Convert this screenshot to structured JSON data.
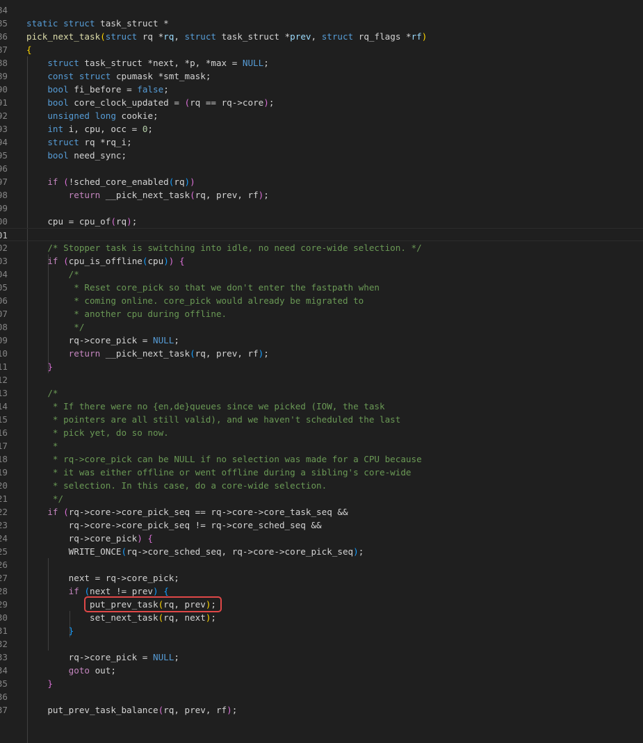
{
  "editor": {
    "language": "c",
    "lines": [
      {
        "n": "84",
        "t": []
      },
      {
        "n": "85",
        "t": [
          [
            "kw",
            "static"
          ],
          [
            "pl",
            " "
          ],
          [
            "kw",
            "struct"
          ],
          [
            "pl",
            " task_struct *"
          ]
        ]
      },
      {
        "n": "86",
        "t": [
          [
            "fn",
            "pick_next_task"
          ],
          [
            "p1",
            "("
          ],
          [
            "kw",
            "struct"
          ],
          [
            "pl",
            " rq *"
          ],
          [
            "var",
            "rq"
          ],
          [
            "pl",
            ", "
          ],
          [
            "kw",
            "struct"
          ],
          [
            "pl",
            " task_struct *"
          ],
          [
            "var",
            "prev"
          ],
          [
            "pl",
            ", "
          ],
          [
            "kw",
            "struct"
          ],
          [
            "pl",
            " rq_flags *"
          ],
          [
            "var",
            "rf"
          ],
          [
            "p1",
            ")"
          ]
        ]
      },
      {
        "n": "87",
        "t": [
          [
            "p1",
            "{"
          ]
        ]
      },
      {
        "n": "88",
        "t": [
          [
            "pl",
            "    "
          ],
          [
            "kw",
            "struct"
          ],
          [
            "pl",
            " task_struct *next, *p, *max = "
          ],
          [
            "kw",
            "NULL"
          ],
          [
            "pl",
            ";"
          ]
        ]
      },
      {
        "n": "89",
        "t": [
          [
            "pl",
            "    "
          ],
          [
            "kw",
            "const"
          ],
          [
            "pl",
            " "
          ],
          [
            "kw",
            "struct"
          ],
          [
            "pl",
            " cpumask *smt_mask;"
          ]
        ]
      },
      {
        "n": "90",
        "t": [
          [
            "pl",
            "    "
          ],
          [
            "kw",
            "bool"
          ],
          [
            "pl",
            " fi_before = "
          ],
          [
            "kw",
            "false"
          ],
          [
            "pl",
            ";"
          ]
        ]
      },
      {
        "n": "91",
        "t": [
          [
            "pl",
            "    "
          ],
          [
            "kw",
            "bool"
          ],
          [
            "pl",
            " core_clock_updated = "
          ],
          [
            "p2",
            "("
          ],
          [
            "pl",
            "rq == rq->core"
          ],
          [
            "p2",
            ")"
          ],
          [
            "pl",
            ";"
          ]
        ]
      },
      {
        "n": "92",
        "t": [
          [
            "pl",
            "    "
          ],
          [
            "kw",
            "unsigned"
          ],
          [
            "pl",
            " "
          ],
          [
            "kw",
            "long"
          ],
          [
            "pl",
            " cookie;"
          ]
        ]
      },
      {
        "n": "93",
        "t": [
          [
            "pl",
            "    "
          ],
          [
            "kw",
            "int"
          ],
          [
            "pl",
            " i, cpu, occ = "
          ],
          [
            "num",
            "0"
          ],
          [
            "pl",
            ";"
          ]
        ]
      },
      {
        "n": "94",
        "t": [
          [
            "pl",
            "    "
          ],
          [
            "kw",
            "struct"
          ],
          [
            "pl",
            " rq *rq_i;"
          ]
        ]
      },
      {
        "n": "95",
        "t": [
          [
            "pl",
            "    "
          ],
          [
            "kw",
            "bool"
          ],
          [
            "pl",
            " need_sync;"
          ]
        ]
      },
      {
        "n": "96",
        "t": []
      },
      {
        "n": "97",
        "t": [
          [
            "pl",
            "    "
          ],
          [
            "ctl",
            "if"
          ],
          [
            "pl",
            " "
          ],
          [
            "p2",
            "("
          ],
          [
            "pl",
            "!sched_core_enabled"
          ],
          [
            "p3",
            "("
          ],
          [
            "pl",
            "rq"
          ],
          [
            "p3",
            ")"
          ],
          [
            "p2",
            ")"
          ]
        ]
      },
      {
        "n": "98",
        "t": [
          [
            "pl",
            "        "
          ],
          [
            "ctl",
            "return"
          ],
          [
            "pl",
            " __pick_next_task"
          ],
          [
            "p2",
            "("
          ],
          [
            "pl",
            "rq, prev, rf"
          ],
          [
            "p2",
            ")"
          ],
          [
            "pl",
            ";"
          ]
        ]
      },
      {
        "n": "99",
        "t": []
      },
      {
        "n": "100",
        "t": [
          [
            "pl",
            "    cpu = cpu_of"
          ],
          [
            "p2",
            "("
          ],
          [
            "pl",
            "rq"
          ],
          [
            "p2",
            ")"
          ],
          [
            "pl",
            ";"
          ]
        ]
      },
      {
        "n": "101",
        "t": [],
        "active": true
      },
      {
        "n": "102",
        "t": [
          [
            "pl",
            "    "
          ],
          [
            "cm",
            "/* Stopper task is switching into idle, no need core-wide selection. */"
          ]
        ]
      },
      {
        "n": "103",
        "t": [
          [
            "pl",
            "    "
          ],
          [
            "ctl",
            "if"
          ],
          [
            "pl",
            " "
          ],
          [
            "p2",
            "("
          ],
          [
            "pl",
            "cpu_is_offline"
          ],
          [
            "p3",
            "("
          ],
          [
            "pl",
            "cpu"
          ],
          [
            "p3",
            ")"
          ],
          [
            "p2",
            ")"
          ],
          [
            "pl",
            " "
          ],
          [
            "p2",
            "{"
          ]
        ]
      },
      {
        "n": "104",
        "t": [
          [
            "pl",
            "        "
          ],
          [
            "cm",
            "/*"
          ]
        ]
      },
      {
        "n": "105",
        "t": [
          [
            "pl",
            "        "
          ],
          [
            "cm",
            " * Reset core_pick so that we don't enter the fastpath when"
          ]
        ]
      },
      {
        "n": "106",
        "t": [
          [
            "pl",
            "        "
          ],
          [
            "cm",
            " * coming online. core_pick would already be migrated to"
          ]
        ]
      },
      {
        "n": "107",
        "t": [
          [
            "pl",
            "        "
          ],
          [
            "cm",
            " * another cpu during offline."
          ]
        ]
      },
      {
        "n": "108",
        "t": [
          [
            "pl",
            "        "
          ],
          [
            "cm",
            " */"
          ]
        ]
      },
      {
        "n": "109",
        "t": [
          [
            "pl",
            "        rq->core_pick = "
          ],
          [
            "kw",
            "NULL"
          ],
          [
            "pl",
            ";"
          ]
        ]
      },
      {
        "n": "110",
        "t": [
          [
            "pl",
            "        "
          ],
          [
            "ctl",
            "return"
          ],
          [
            "pl",
            " __pick_next_task"
          ],
          [
            "p3",
            "("
          ],
          [
            "pl",
            "rq, prev, rf"
          ],
          [
            "p3",
            ")"
          ],
          [
            "pl",
            ";"
          ]
        ]
      },
      {
        "n": "111",
        "t": [
          [
            "pl",
            "    "
          ],
          [
            "p2",
            "}"
          ]
        ]
      },
      {
        "n": "112",
        "t": []
      },
      {
        "n": "113",
        "t": [
          [
            "pl",
            "    "
          ],
          [
            "cm",
            "/*"
          ]
        ]
      },
      {
        "n": "114",
        "t": [
          [
            "pl",
            "    "
          ],
          [
            "cm",
            " * If there were no {en,de}queues since we picked (IOW, the task"
          ]
        ]
      },
      {
        "n": "115",
        "t": [
          [
            "pl",
            "    "
          ],
          [
            "cm",
            " * pointers are all still valid), and we haven't scheduled the last"
          ]
        ]
      },
      {
        "n": "116",
        "t": [
          [
            "pl",
            "    "
          ],
          [
            "cm",
            " * pick yet, do so now."
          ]
        ]
      },
      {
        "n": "117",
        "t": [
          [
            "pl",
            "    "
          ],
          [
            "cm",
            " *"
          ]
        ]
      },
      {
        "n": "118",
        "t": [
          [
            "pl",
            "    "
          ],
          [
            "cm",
            " * rq->core_pick can be NULL if no selection was made for a CPU because"
          ]
        ]
      },
      {
        "n": "119",
        "t": [
          [
            "pl",
            "    "
          ],
          [
            "cm",
            " * it was either offline or went offline during a sibling's core-wide"
          ]
        ]
      },
      {
        "n": "120",
        "t": [
          [
            "pl",
            "    "
          ],
          [
            "cm",
            " * selection. In this case, do a core-wide selection."
          ]
        ]
      },
      {
        "n": "121",
        "t": [
          [
            "pl",
            "    "
          ],
          [
            "cm",
            " */"
          ]
        ]
      },
      {
        "n": "122",
        "t": [
          [
            "pl",
            "    "
          ],
          [
            "ctl",
            "if"
          ],
          [
            "pl",
            " "
          ],
          [
            "p2",
            "("
          ],
          [
            "pl",
            "rq->core->core_pick_seq == rq->core->core_task_seq &&"
          ]
        ]
      },
      {
        "n": "123",
        "t": [
          [
            "pl",
            "        rq->core->core_pick_seq != rq->core_sched_seq &&"
          ]
        ]
      },
      {
        "n": "124",
        "t": [
          [
            "pl",
            "        rq->core_pick"
          ],
          [
            "p2",
            ")"
          ],
          [
            "pl",
            " "
          ],
          [
            "p2",
            "{"
          ]
        ]
      },
      {
        "n": "125",
        "t": [
          [
            "pl",
            "        WRITE_ONCE"
          ],
          [
            "p3",
            "("
          ],
          [
            "pl",
            "rq->core_sched_seq, rq->core->core_pick_seq"
          ],
          [
            "p3",
            ")"
          ],
          [
            "pl",
            ";"
          ]
        ]
      },
      {
        "n": "126",
        "t": []
      },
      {
        "n": "127",
        "t": [
          [
            "pl",
            "        next = rq->core_pick;"
          ]
        ]
      },
      {
        "n": "128",
        "t": [
          [
            "pl",
            "        "
          ],
          [
            "ctl",
            "if"
          ],
          [
            "pl",
            " "
          ],
          [
            "p3",
            "("
          ],
          [
            "pl",
            "next != prev"
          ],
          [
            "p3",
            ")"
          ],
          [
            "pl",
            " "
          ],
          [
            "p3",
            "{"
          ]
        ]
      },
      {
        "n": "129",
        "t": [
          [
            "pl",
            "            put_prev_task"
          ],
          [
            "p1",
            "("
          ],
          [
            "pl",
            "rq, prev"
          ],
          [
            "p1",
            ")"
          ],
          [
            "pl",
            ";"
          ]
        ]
      },
      {
        "n": "130",
        "t": [
          [
            "pl",
            "            set_next_task"
          ],
          [
            "p1",
            "("
          ],
          [
            "pl",
            "rq, next"
          ],
          [
            "p1",
            ")"
          ],
          [
            "pl",
            ";"
          ]
        ]
      },
      {
        "n": "131",
        "t": [
          [
            "pl",
            "        "
          ],
          [
            "p3",
            "}"
          ]
        ]
      },
      {
        "n": "132",
        "t": []
      },
      {
        "n": "133",
        "t": [
          [
            "pl",
            "        rq->core_pick = "
          ],
          [
            "kw",
            "NULL"
          ],
          [
            "pl",
            ";"
          ]
        ]
      },
      {
        "n": "134",
        "t": [
          [
            "pl",
            "        "
          ],
          [
            "ctl",
            "goto"
          ],
          [
            "pl",
            " out;"
          ]
        ]
      },
      {
        "n": "135",
        "t": [
          [
            "pl",
            "    "
          ],
          [
            "p2",
            "}"
          ]
        ]
      },
      {
        "n": "136",
        "t": []
      },
      {
        "n": "137",
        "t": [
          [
            "pl",
            "    put_prev_task_balance"
          ],
          [
            "p2",
            "("
          ],
          [
            "pl",
            "rq, prev, rf"
          ],
          [
            "p2",
            ")"
          ],
          [
            "pl",
            ";"
          ]
        ]
      }
    ]
  },
  "highlight": {
    "line": "129",
    "label": "put_prev_task(rq, prev);"
  },
  "colors": {
    "background": "#1f1f1f",
    "keyword": "#569cd6",
    "control": "#c586c0",
    "comment": "#6a9955",
    "highlight_box": "#e04848"
  }
}
